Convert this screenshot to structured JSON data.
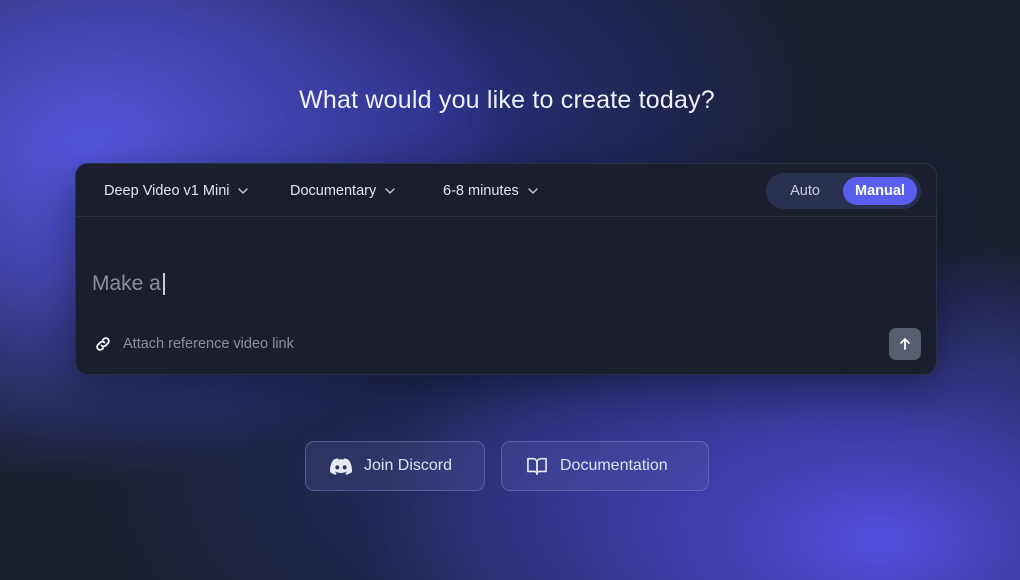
{
  "headline": "What would you like to create today?",
  "toolbar": {
    "model": {
      "label": "Deep Video v1 Mini",
      "icon": "chevron-down-icon"
    },
    "style": {
      "label": "Documentary",
      "icon": "chevron-down-icon"
    },
    "duration": {
      "label": "6-8 minutes",
      "icon": "chevron-down-icon"
    },
    "mode_toggle": {
      "options": [
        "Auto",
        "Manual"
      ],
      "selected": "Manual"
    }
  },
  "prompt": {
    "value": "Make a",
    "placeholder": ""
  },
  "attach": {
    "icon": "link-icon",
    "label": "Attach reference video link"
  },
  "send": {
    "icon": "arrow-up-icon"
  },
  "links": {
    "discord": {
      "label": "Join Discord",
      "icon": "discord-icon"
    },
    "docs": {
      "label": "Documentation",
      "icon": "book-icon"
    }
  },
  "colors": {
    "accent": "#5a5ef0",
    "card_bg": "#1b1e2e",
    "page_bg": "#1b2033"
  }
}
